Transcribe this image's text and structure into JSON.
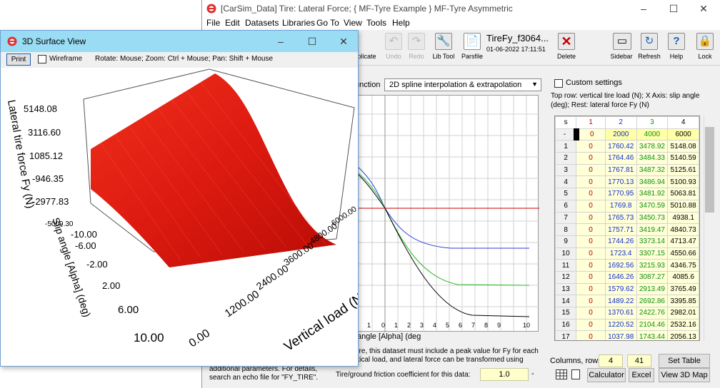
{
  "main_window": {
    "title": "[CarSim_Data] Tire: Lateral Force; { MF-Tyre Example } MF-Tyre Asymmetric",
    "menu": [
      "File",
      "Edit",
      "Datasets",
      "Libraries",
      "Go To",
      "View",
      "Tools",
      "Help"
    ],
    "toolbar": {
      "duplicate": "uplicate",
      "undo": "Undo",
      "redo": "Redo",
      "lib_tool": "Lib Tool",
      "parsfile": "Parsfile",
      "dataset_name": "TireFy_f3064...",
      "dataset_date": "01-06-2022 17:11:51",
      "delete": "Delete",
      "sidebar": "Sidebar",
      "refresh": "Refresh",
      "help": "Help",
      "lock": "Lock"
    },
    "function_label": "unction",
    "function_select": "2D spline interpolation & extrapolation",
    "custom_settings": "Custom settings",
    "table_description": "Top row: vertical tire load (N); X Axis: slip angle (deg); Rest: lateral force Fy (N)",
    "x_axis_label": "angle [Alpha] (deg",
    "x_tick_labels": [
      "1",
      "0",
      "1",
      "2",
      "3",
      "4",
      "5",
      "6",
      "7",
      "8",
      "9",
      "10"
    ],
    "bottom_text_1": "ore, this dataset must include a peak value for Fy for each",
    "bottom_text_2": "rtical load, and lateral force can be transformed using",
    "bottom_text_3": "additional parameters. For details,",
    "bottom_text_4": "search an echo file for \"FY_TIRE\".",
    "friction_label": "Tire/ground friction coefficient for this data:",
    "friction_value": "1.0",
    "friction_dash": "-",
    "columns_rows_label": "Columns, rows:",
    "columns": "4",
    "rows": "41",
    "set_table_size": "Set Table Size",
    "calculator": "Calculator",
    "excel": "Excel",
    "view_3d_map": "View 3D Map"
  },
  "table": {
    "col_headers": [
      "s",
      "1",
      "2",
      "3",
      "4"
    ],
    "top_row": [
      "-",
      "0",
      "2000",
      "4000",
      "6000"
    ],
    "rows": [
      [
        "1",
        "0",
        "1760.42",
        "3478.92",
        "5148.08"
      ],
      [
        "2",
        "0",
        "1764.46",
        "3484.33",
        "5140.59"
      ],
      [
        "3",
        "0",
        "1767.81",
        "3487.32",
        "5125.61"
      ],
      [
        "4",
        "0",
        "1770.13",
        "3486.94",
        "5100.93"
      ],
      [
        "5",
        "0",
        "1770.95",
        "3481.92",
        "5063.81"
      ],
      [
        "6",
        "0",
        "1769.8",
        "3470.59",
        "5010.88"
      ],
      [
        "7",
        "0",
        "1765.73",
        "3450.73",
        "4938.1"
      ],
      [
        "8",
        "0",
        "1757.71",
        "3419.47",
        "4840.73"
      ],
      [
        "9",
        "0",
        "1744.26",
        "3373.14",
        "4713.47"
      ],
      [
        "10",
        "0",
        "1723.4",
        "3307.15",
        "4550.66"
      ],
      [
        "11",
        "0",
        "1692.56",
        "3215.93",
        "4346.75"
      ],
      [
        "12",
        "0",
        "1646.26",
        "3087.27",
        "4085.6"
      ],
      [
        "13",
        "0",
        "1579.62",
        "2913.49",
        "3765.49"
      ],
      [
        "14",
        "0",
        "1489.22",
        "2692.86",
        "3395.85"
      ],
      [
        "15",
        "0",
        "1370.61",
        "2422.76",
        "2982.01"
      ],
      [
        "16",
        "0",
        "1220.52",
        "2104.46",
        "2532.16"
      ],
      [
        "17",
        "0",
        "1037.98",
        "1743.44",
        "2056.13"
      ]
    ]
  },
  "window_3d": {
    "title": "3D Surface View",
    "print": "Print",
    "wireframe": "Wireframe",
    "hint": "Rotate: Mouse; Zoom: Ctrl + Mouse; Pan: Shift + Mouse",
    "z_axis_label": "Lateral tire force Fy (N)",
    "z_ticks": [
      "5148.08",
      "3116.60",
      "1085.12",
      "-946.35",
      "-2977.83",
      "-5009.30"
    ],
    "slip_axis_label": "Slip angle [Alpha] (deg)",
    "slip_ticks": [
      "-10.00",
      "-6.00",
      "-2.00",
      "2.00",
      "6.00",
      "10.00"
    ],
    "load_axis_label": "Vertical load (N)",
    "load_ticks": [
      "0.00",
      "1200.00",
      "2400.00",
      "3600.00",
      "4800.00",
      "6000.00"
    ]
  },
  "colors": {
    "surface": "#dd1a10",
    "series_2000": "#2a3fd8",
    "series_4000": "#2cb82c",
    "series_6000": "#000000",
    "zero_line": "#c80000",
    "title_bar_3d": "#99dcf3"
  }
}
